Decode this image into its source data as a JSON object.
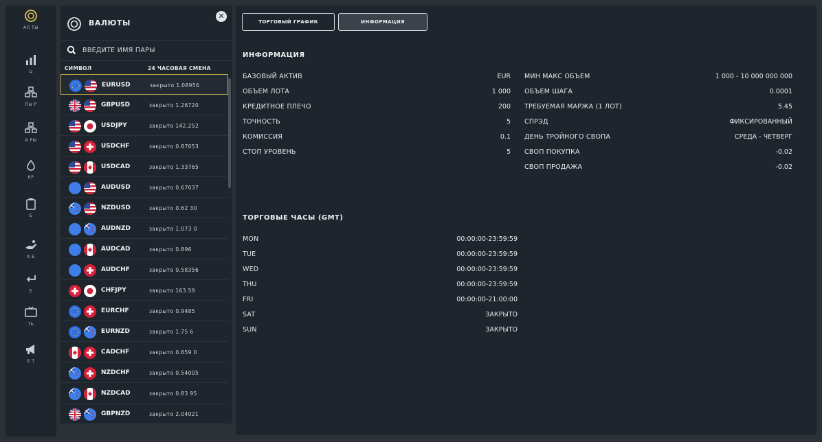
{
  "rail": [
    {
      "icon": "coin-icon",
      "label": "АЛ  ТЫ"
    },
    {
      "icon": "bar-chart-icon",
      "label": "Ц"
    },
    {
      "icon": "boxes-icon",
      "label": "ПЫ  Р"
    },
    {
      "icon": "boxes-icon",
      "label": "А РЫ"
    },
    {
      "icon": "drop-icon",
      "label": "КР"
    },
    {
      "icon": "clipboard-icon",
      "label": "Б"
    },
    {
      "icon": "hand-icon",
      "label": "А    Б"
    },
    {
      "icon": "return-icon",
      "label": "Е"
    },
    {
      "icon": "tv-icon",
      "label": "ТЬ"
    },
    {
      "icon": "megaphone-icon",
      "label": "Б   Т"
    }
  ],
  "panel": {
    "title": "ВАЛЮТЫ",
    "search_placeholder": "ВВЕДИТЕ ИМЯ ПАРЫ",
    "col_symbol": "СИМВОЛ",
    "col_change": "24 ЧАСОВАЯ СМЕНА",
    "rows": [
      {
        "symbol": "EURUSD",
        "change": "закрыто  1.08956",
        "flags": [
          "eu",
          "us"
        ]
      },
      {
        "symbol": "GBPUSD",
        "change": "закрыто  1.26720",
        "flags": [
          "gb",
          "us"
        ]
      },
      {
        "symbol": "USDJPY",
        "change": "закрыто  142.252",
        "flags": [
          "us",
          "jp"
        ]
      },
      {
        "symbol": "USDCHF",
        "change": "закрыто  0.87053",
        "flags": [
          "us",
          "ch"
        ]
      },
      {
        "symbol": "USDCAD",
        "change": "закрыто  1.33765",
        "flags": [
          "us",
          "ca"
        ]
      },
      {
        "symbol": "AUDUSD",
        "change": "закрыто  0.67037",
        "flags": [
          "au",
          "us"
        ]
      },
      {
        "symbol": "NZDUSD",
        "change": "закрыто  0.62 30",
        "flags": [
          "nz",
          "us"
        ]
      },
      {
        "symbol": "AUDNZD",
        "change": "закрыто  1.073 0",
        "flags": [
          "au",
          "nz"
        ]
      },
      {
        "symbol": "AUDCAD",
        "change": "закрыто  0.896",
        "flags": [
          "au",
          "ca"
        ]
      },
      {
        "symbol": "AUDCHF",
        "change": "закрыто  0.58356",
        "flags": [
          "au",
          "ch"
        ]
      },
      {
        "symbol": "CHFJPY",
        "change": "закрыто  163.59",
        "flags": [
          "ch",
          "jp"
        ]
      },
      {
        "symbol": "EURCHF",
        "change": "закрыто  0.9485",
        "flags": [
          "eu",
          "ch"
        ]
      },
      {
        "symbol": "EURNZD",
        "change": "закрыто  1.75 6",
        "flags": [
          "eu",
          "nz"
        ]
      },
      {
        "symbol": "CADCHF",
        "change": "закрыто  0.659 0",
        "flags": [
          "ca",
          "ch"
        ]
      },
      {
        "symbol": "NZDCHF",
        "change": "закрыто  0.54005",
        "flags": [
          "nz",
          "ch"
        ]
      },
      {
        "symbol": "NZDCAD",
        "change": "закрыто  0.83 95",
        "flags": [
          "nz",
          "ca"
        ]
      },
      {
        "symbol": "GBPNZD",
        "change": "закрыто  2.04021",
        "flags": [
          "gb",
          "nz"
        ]
      }
    ]
  },
  "tabs": [
    {
      "label": "ТОРГОВЫЙ ГРАФИК",
      "active": false
    },
    {
      "label": "ИНФОРМАЦИЯ",
      "active": true
    }
  ],
  "info": {
    "title": "ИНФОРМАЦИЯ",
    "left": [
      {
        "k": "БАЗОВЫЙ АКТИВ",
        "v": "EUR"
      },
      {
        "k": "ОБЪЕМ ЛОТА",
        "v": "1 000"
      },
      {
        "k": "КРЕДИТНОЕ ПЛЕЧО",
        "v": "200"
      },
      {
        "k": "ТОЧНОСТЬ",
        "v": "5"
      },
      {
        "k": "КОМИССИЯ",
        "v": "0.1"
      },
      {
        "k": "СТОП УРОВЕНЬ",
        "v": "5"
      }
    ],
    "right": [
      {
        "k": "МИН МАКС ОБЪЕМ",
        "v": "1 000 - 10 000 000 000"
      },
      {
        "k": "ОБЪЕМ ШАГА",
        "v": "0.0001"
      },
      {
        "k": "ТРЕБУЕМАЯ МАРЖА (1 ЛОТ)",
        "v": "5.45"
      },
      {
        "k": "СПРЭД",
        "v": "ФИКСИРОВАННЫЙ"
      },
      {
        "k": "ДЕНЬ ТРОЙНОГО СВОПА",
        "v": "СРЕДА - ЧЕТВЕРГ"
      },
      {
        "k": "СВОП ПОКУПКА",
        "v": "-0.02"
      },
      {
        "k": "СВОП ПРОДАЖА",
        "v": "-0.02"
      }
    ]
  },
  "hours": {
    "title": "ТОРГОВЫЕ ЧАСЫ (GMT)",
    "rows": [
      {
        "k": "MON",
        "v": "00:00:00-23:59:59"
      },
      {
        "k": "TUE",
        "v": "00:00:00-23:59:59"
      },
      {
        "k": "WED",
        "v": "00:00:00-23:59:59"
      },
      {
        "k": "THU",
        "v": "00:00:00-23:59:59"
      },
      {
        "k": "FRI",
        "v": "00:00:00-21:00:00"
      },
      {
        "k": "SAT",
        "v": "ЗАКРЫТО"
      },
      {
        "k": "SUN",
        "v": "ЗАКРЫТО"
      }
    ]
  }
}
